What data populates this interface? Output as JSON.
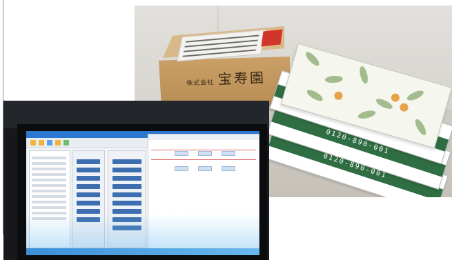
{
  "photos": {
    "packages": {
      "box_print_small": "株式会社",
      "box_print_brand": "宝寿園",
      "band_text": "0120-890-001"
    },
    "monitor": {}
  },
  "colors": {
    "cardboard": "#caa068",
    "tea_band_green": "#2f6e43",
    "screen_blue": "#2c78d0"
  }
}
